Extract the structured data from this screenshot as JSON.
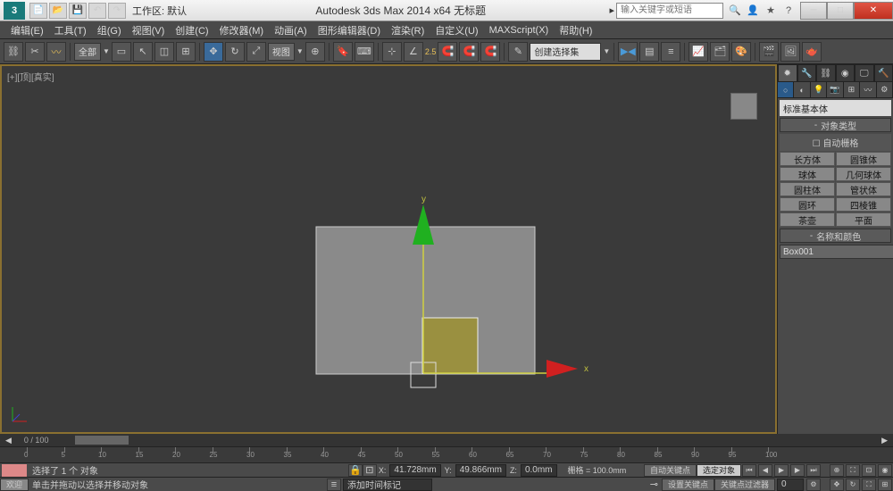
{
  "titlebar": {
    "workspace": "工作区: 默认",
    "title": "Autodesk 3ds Max  2014 x64   无标题",
    "search_placeholder": "输入关键字或短语"
  },
  "menu": [
    "编辑(E)",
    "工具(T)",
    "组(G)",
    "视图(V)",
    "创建(C)",
    "修改器(M)",
    "动画(A)",
    "图形编辑器(D)",
    "渲染(R)",
    "自定义(U)",
    "MAXScript(X)",
    "帮助(H)"
  ],
  "toolbar": {
    "filter": "全部",
    "view": "视图",
    "angle": "2.5",
    "selset": "创建选择集"
  },
  "viewport": {
    "label": "[+][顶][真实]",
    "y_axis": "y",
    "x_axis": "x"
  },
  "scrollbar": {
    "pos": "0 / 100"
  },
  "cmdpanel": {
    "drop": "标准基本体",
    "rollout1": "对象类型",
    "autogrid": "自动栅格",
    "objects": [
      "长方体",
      "圆锥体",
      "球体",
      "几何球体",
      "圆柱体",
      "管状体",
      "圆环",
      "四棱锥",
      "茶壶",
      "平面"
    ],
    "rollout2": "名称和颜色",
    "name": "Box001"
  },
  "timeline": {
    "ticks": [
      0,
      5,
      10,
      15,
      20,
      25,
      30,
      35,
      40,
      45,
      50,
      55,
      60,
      65,
      70,
      75,
      80,
      85,
      90,
      95,
      100
    ]
  },
  "status": {
    "line1": "选择了 1 个 对象",
    "line2": "单击并拖动以选择并移动对象",
    "x": "41.728mm",
    "y": "49.866mm",
    "z": "0.0mm",
    "grid": "栅格 = 100.0mm",
    "autokey": "自动关键点",
    "selset_lbl": "选定对象",
    "setkey": "设置关键点",
    "keyfilter": "关键点过滤器",
    "addtime": "添加时间标记",
    "welcome": "欢迎"
  }
}
